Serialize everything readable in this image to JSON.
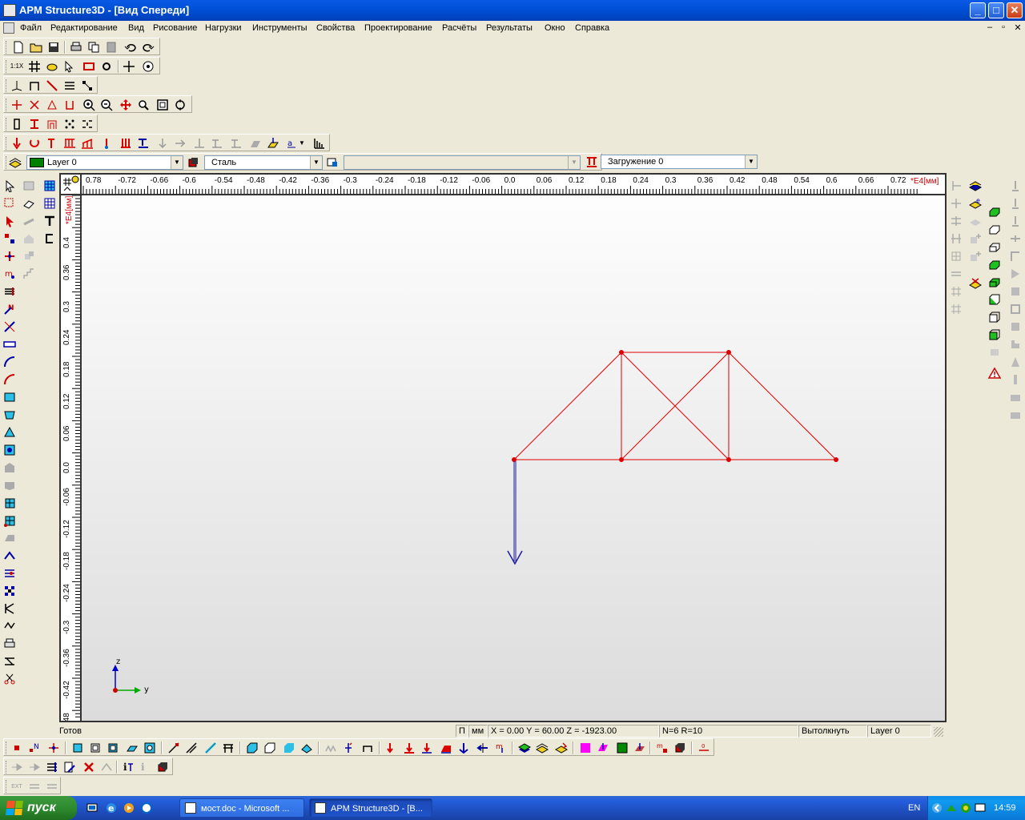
{
  "window": {
    "title": "APM Structure3D - [Вид Спереди]",
    "controls": {
      "minimize": "_",
      "maximize": "□",
      "close": "✕"
    }
  },
  "menu": {
    "items": [
      "Файл",
      "Редактирование",
      "Вид",
      "Рисование",
      "Нагрузки",
      "Инструменты",
      "Свойства",
      "Проектирование",
      "Расчёты",
      "Результаты",
      "Окно",
      "Справка"
    ],
    "mdi_controls": [
      "–",
      "▫",
      "✕"
    ]
  },
  "toolbars": {
    "toolbar2_text": "1:1X",
    "layer_combo": "Layer 0",
    "material_combo": "Сталь",
    "section_combo": "",
    "load_combo": "Загружение 0"
  },
  "ruler": {
    "h_labels": [
      "0.78",
      "-0.72",
      "-0.66",
      "-0.6",
      "-0.54",
      "-0.48",
      "-0.42",
      "-0.36",
      "-0.3",
      "-0.24",
      "-0.18",
      "-0.12",
      "-0.06",
      "0.0",
      "0.06",
      "0.12",
      "0.18",
      "0.24",
      "0.3",
      "0.36",
      "0.42",
      "0.48",
      "0.54",
      "0.6",
      "0.66",
      "0.72"
    ],
    "h_unit": "*E4[мм]",
    "v_labels": [
      "0.4",
      "0.36",
      "0.3",
      "0.24",
      "0.18",
      "0.12",
      "0.06",
      "0.0",
      "-0.06",
      "-0.12",
      "-0.18",
      "-0.24",
      "-0.3",
      "-0.36",
      "-0.42",
      "-0.48"
    ],
    "v_unit": "*E4[мм]"
  },
  "model": {
    "colors": {
      "frame": "#e00000",
      "load": "#1a1aa0",
      "axis_z": "#0000cc",
      "axis_y": "#00aa00"
    }
  },
  "axes": {
    "z_label": "z",
    "y_label": "y"
  },
  "status": {
    "ready": "Готов",
    "mode": "П",
    "units": "мм",
    "coords": "X = 0.00 Y = 60.00 Z = -1923.00",
    "counts": "N=6 R=10",
    "action": "Вытолкнуть",
    "layer": "Layer 0"
  },
  "taskbar": {
    "start": "пуск",
    "tasks": [
      "мост.doc - Microsoft ...",
      "APM Structure3D - [В..."
    ],
    "lang": "EN",
    "clock": "14:59"
  }
}
